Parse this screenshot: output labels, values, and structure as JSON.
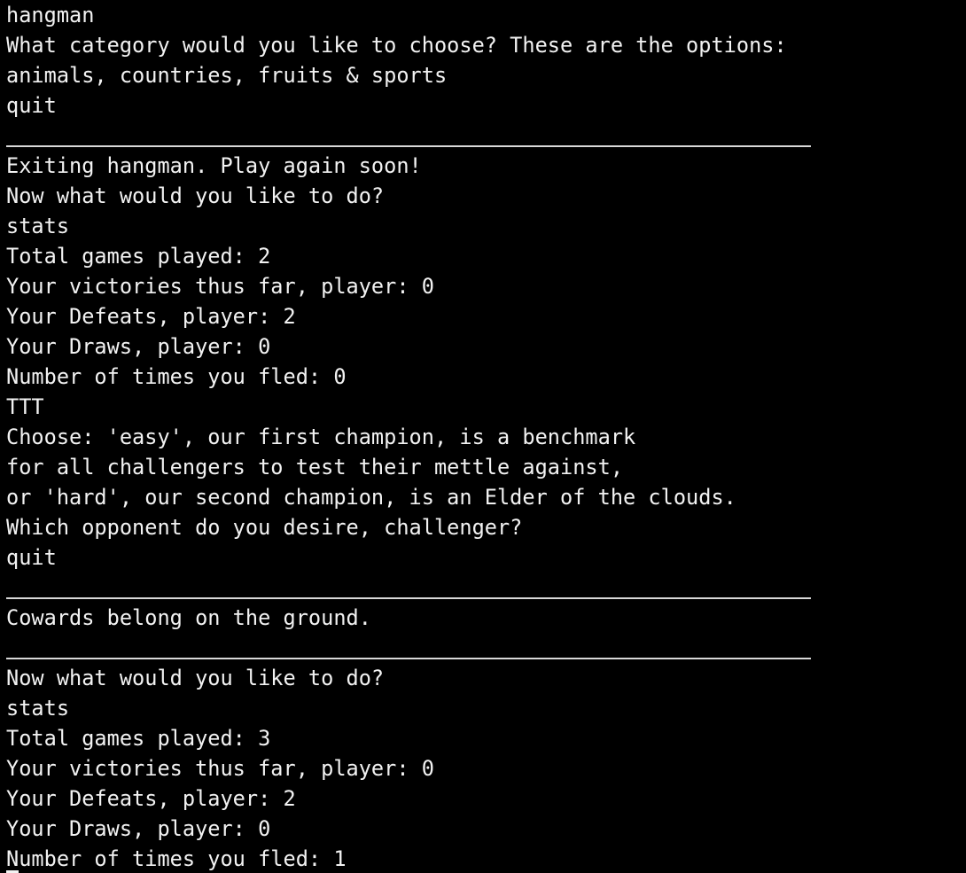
{
  "terminal": {
    "lines": [
      "hangman",
      "What category would you like to choose? These are the options:",
      "animals, countries, fruits & sports",
      "quit",
      "",
      "Exiting hangman. Play again soon!",
      "Now what would you like to do?",
      "stats",
      "Total games played: 2",
      "Your victories thus far, player: 0",
      "Your Defeats, player: 2",
      "Your Draws, player: 0",
      "Number of times you fled: 0",
      "TTT",
      "Choose: 'easy', our first champion, is a benchmark",
      "for all challengers to test their mettle against,",
      "or 'hard', our second champion, is an Elder of the clouds.",
      "Which opponent do you desire, challenger?",
      "quit",
      "",
      "Cowards belong on the ground.",
      "",
      "Now what would you like to do?",
      "stats",
      "Total games played: 3",
      "Your victories thus far, player: 0",
      "Your Defeats, player: 2",
      "Your Draws, player: 0",
      "Number of times you fled: 1"
    ]
  },
  "colors": {
    "background": "#000000",
    "text": "#f2f2f2",
    "separator": "#d8d8d8"
  }
}
